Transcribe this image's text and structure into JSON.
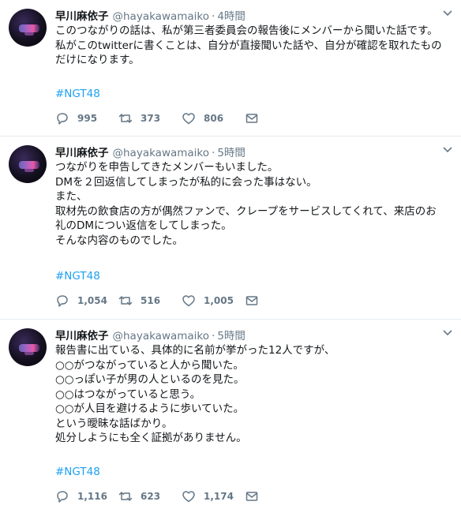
{
  "tweets": [
    {
      "name": "早川麻依子",
      "handle": "@hayakawamaiko",
      "separator": "·",
      "time": "4時間",
      "lines": [
        "このつながりの話は、私が第三者委員会の報告後にメンバーから聞いた話です。",
        "私がこのtwitterに書くことは、自分が直接聞いた話や、自分が確認を取れたもの",
        "だけになります。"
      ],
      "hashtag": "#NGT48",
      "replies": "995",
      "retweets": "373",
      "likes": "806"
    },
    {
      "name": "早川麻依子",
      "handle": "@hayakawamaiko",
      "separator": "·",
      "time": "5時間",
      "lines": [
        "つながりを申告してきたメンバーもいました。",
        "DMを２回返信してしまったが私的に会った事はない。",
        "また、",
        "取材先の飲食店の方が偶然ファンで、クレープをサービスしてくれて、来店のお",
        "礼のDMについ返信をしてしまった。",
        "そんな内容のものでした。"
      ],
      "hashtag": "#NGT48",
      "replies": "1,054",
      "retweets": "516",
      "likes": "1,005"
    },
    {
      "name": "早川麻依子",
      "handle": "@hayakawamaiko",
      "separator": "·",
      "time": "5時間",
      "lines": [
        "報告書に出ている、具体的に名前が挙がった12人ですが、",
        "○○がつながっていると人から聞いた。",
        "○○っぽい子が男の人といるのを見た。",
        "○○はつながっていると思う。",
        "○○が人目を避けるように歩いていた。",
        "という曖昧な話ばかり。",
        "処分しようにも全く証拠がありません。"
      ],
      "hashtag": "#NGT48",
      "replies": "1,116",
      "retweets": "623",
      "likes": "1,174"
    }
  ],
  "icons": {
    "avatar": "avatar",
    "caret": "chevron-down-icon",
    "reply": "reply-icon",
    "retweet": "retweet-icon",
    "like": "heart-icon",
    "message": "envelope-icon"
  },
  "colors": {
    "text": "#14171a",
    "muted": "#657786",
    "link": "#1da1f2",
    "divider": "#e6ecf0"
  }
}
